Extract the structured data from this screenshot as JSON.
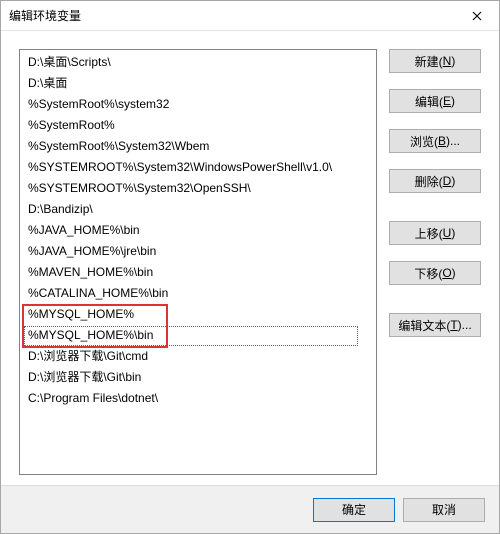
{
  "window": {
    "title": "编辑环境变量"
  },
  "list": {
    "items": [
      "D:\\桌面\\Scripts\\",
      "D:\\桌面",
      "%SystemRoot%\\system32",
      "%SystemRoot%",
      "%SystemRoot%\\System32\\Wbem",
      "%SYSTEMROOT%\\System32\\WindowsPowerShell\\v1.0\\",
      "%SYSTEMROOT%\\System32\\OpenSSH\\",
      "D:\\Bandizip\\",
      "%JAVA_HOME%\\bin",
      "%JAVA_HOME%\\jre\\bin",
      "%MAVEN_HOME%\\bin",
      "%CATALINA_HOME%\\bin",
      "%MYSQL_HOME%",
      "%MYSQL_HOME%\\bin",
      "D:\\浏览器下载\\Git\\cmd",
      "D:\\浏览器下载\\Git\\bin",
      "C:\\Program Files\\dotnet\\"
    ],
    "highlighted_rows": [
      12,
      13
    ],
    "focused_row": 13
  },
  "buttons": {
    "new": {
      "label": "新建(",
      "accel": "N",
      "tail": ")"
    },
    "edit": {
      "label": "编辑(",
      "accel": "E",
      "tail": ")"
    },
    "browse": {
      "label": "浏览(",
      "accel": "B",
      "tail": ")..."
    },
    "delete": {
      "label": "删除(",
      "accel": "D",
      "tail": ")"
    },
    "moveup": {
      "label": "上移(",
      "accel": "U",
      "tail": ")"
    },
    "movedown": {
      "label": "下移(",
      "accel": "O",
      "tail": ")"
    },
    "edittext": {
      "label": "编辑文本(",
      "accel": "T",
      "tail": ")..."
    }
  },
  "footer": {
    "ok": "确定",
    "cancel": "取消"
  },
  "colors": {
    "highlight_border": "#d33",
    "button_bg": "#e1e1e1",
    "button_border": "#adadad",
    "primary_border": "#0078d7",
    "footer_bg": "#f0f0f0"
  }
}
